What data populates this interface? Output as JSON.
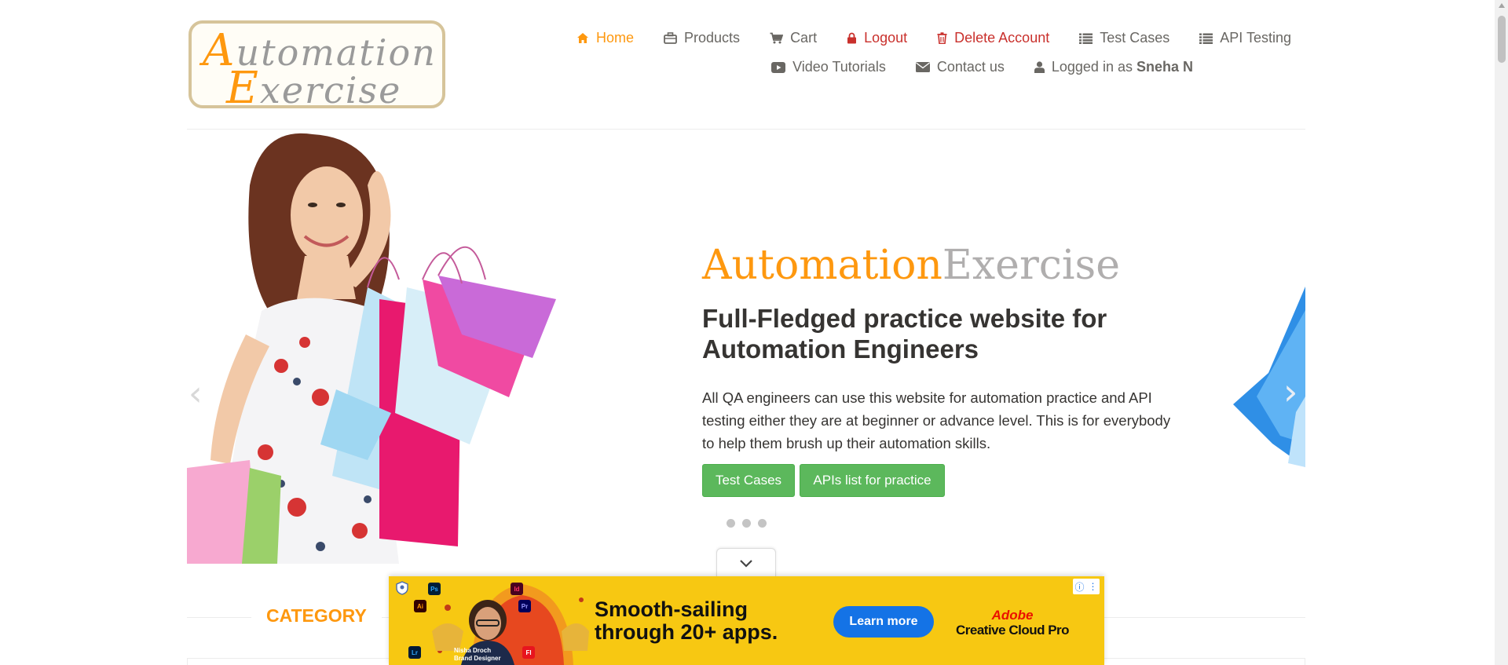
{
  "logo": {
    "line1_cap": "A",
    "line1_rest": "utomation",
    "line2_cap": "E",
    "line2_rest": "xercise"
  },
  "nav": {
    "row1": [
      {
        "icon": "home-icon",
        "label": "Home"
      },
      {
        "icon": "briefcase-icon",
        "label": "Products"
      },
      {
        "icon": "cart-icon",
        "label": "Cart"
      },
      {
        "icon": "lock-icon",
        "label": "Logout"
      },
      {
        "icon": "trash-icon",
        "label": "Delete Account"
      },
      {
        "icon": "list-icon",
        "label": "Test Cases"
      },
      {
        "icon": "list-icon",
        "label": "API Testing"
      }
    ],
    "row2": [
      {
        "icon": "video-icon",
        "label": "Video Tutorials"
      },
      {
        "icon": "envelope-icon",
        "label": "Contact us"
      },
      {
        "icon": "user-icon",
        "label": "Logged in as",
        "user": "Sneha N"
      }
    ]
  },
  "hero": {
    "title_a": "Automation",
    "title_b": "Exercise",
    "subtitle": "Full-Fledged practice website for Automation Engineers",
    "description": "All QA engineers can use this website for automation practice and API testing either they are at beginner or advance level. This is for everybody to help them brush up their automation skills.",
    "btn_test_cases": "Test Cases",
    "btn_apis": "APIs list for practice",
    "prev_arrow": "‹",
    "next_arrow": "›"
  },
  "category": {
    "title": "CATEGORY"
  },
  "ad": {
    "headline_line1": "Smooth-sailing",
    "headline_line2": "through 20+ apps.",
    "cta": "Learn more",
    "brand_line1": "Adobe",
    "brand_line2": "Creative Cloud Pro",
    "person_name": "Nisha Droch",
    "person_title": "Brand Designer",
    "app_badges": [
      "Ps",
      "Id",
      "Ai",
      "Pr",
      "Lr",
      "Fl"
    ]
  },
  "colors": {
    "accent": "#fe980f",
    "danger": "#c9302c",
    "button": "#5cb85c",
    "ad_bg": "#f7c812"
  }
}
